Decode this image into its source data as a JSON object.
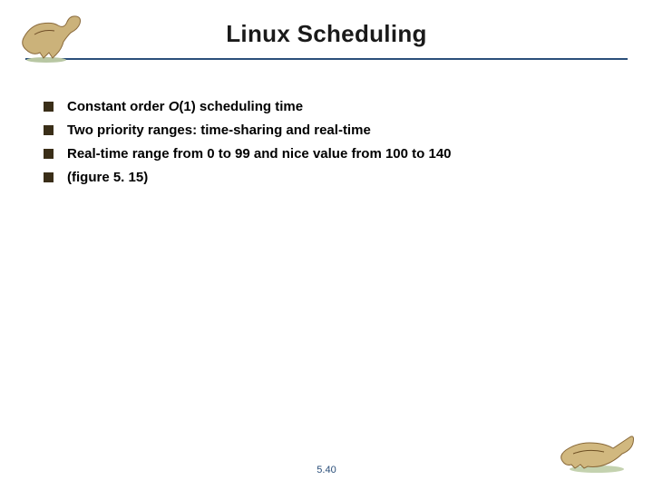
{
  "slide": {
    "title": "Linux Scheduling",
    "page_number": "5.40"
  },
  "bullets": [
    {
      "segments": [
        {
          "text": "Constant order "
        },
        {
          "text": "O",
          "style": "i"
        },
        {
          "text": "(1) scheduling time"
        }
      ]
    },
    {
      "segments": [
        {
          "text": "Two priority ranges: time-sharing and real-time"
        }
      ]
    },
    {
      "segments": [
        {
          "text": "Real-time "
        },
        {
          "text": "range from 0 to 99 and "
        },
        {
          "text": "nice "
        },
        {
          "text": "value from 100 to 140"
        }
      ]
    },
    {
      "segments": [
        {
          "text": "(figure 5. 15)"
        }
      ]
    }
  ],
  "decor": {
    "top_logo_alt": "dinosaur-running-illustration",
    "bottom_logo_alt": "dinosaur-crouching-illustration"
  }
}
